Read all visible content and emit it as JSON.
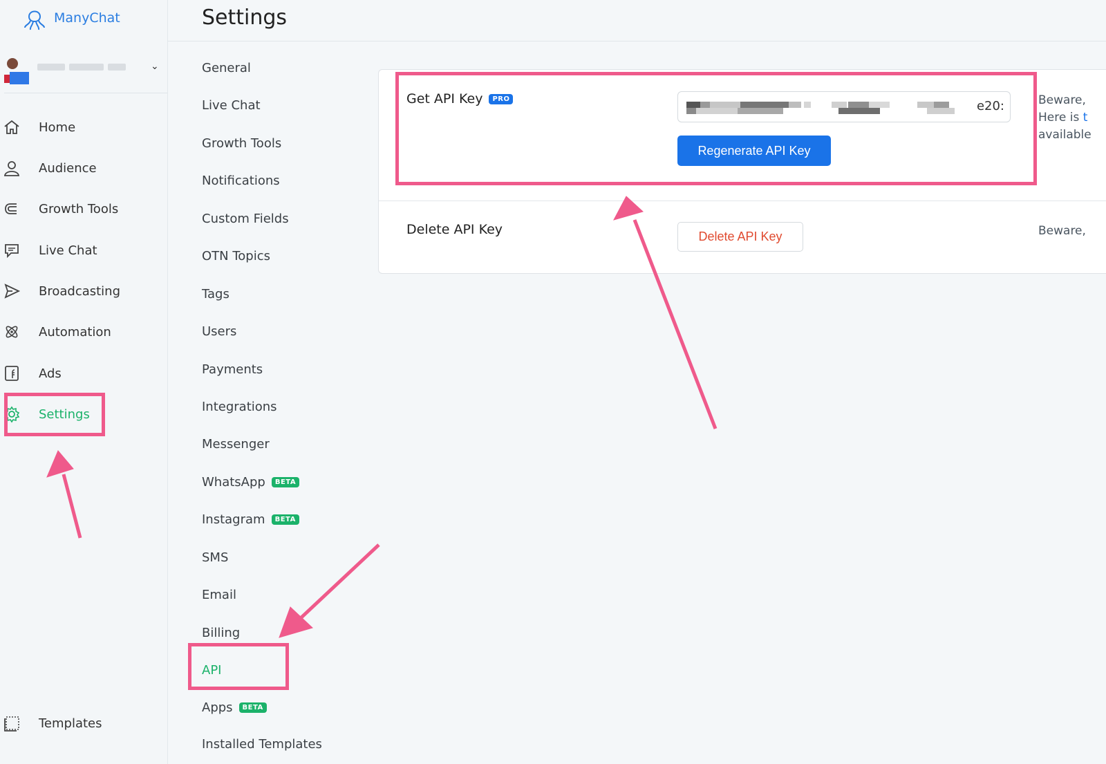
{
  "app": {
    "name": "ManyChat"
  },
  "page_title": "Settings",
  "sidebar": {
    "items": [
      {
        "label": "Home",
        "icon": "home-icon"
      },
      {
        "label": "Audience",
        "icon": "user-icon"
      },
      {
        "label": "Growth Tools",
        "icon": "magnet-icon"
      },
      {
        "label": "Live Chat",
        "icon": "chat-icon"
      },
      {
        "label": "Broadcasting",
        "icon": "send-icon"
      },
      {
        "label": "Automation",
        "icon": "atom-icon"
      },
      {
        "label": "Ads",
        "icon": "facebook-ads-icon"
      },
      {
        "label": "Settings",
        "icon": "gear-icon",
        "active": true
      }
    ],
    "bottom_item": {
      "label": "Templates",
      "icon": "templates-icon"
    }
  },
  "settings_menu": {
    "items": [
      {
        "label": "General"
      },
      {
        "label": "Live Chat"
      },
      {
        "label": "Growth Tools"
      },
      {
        "label": "Notifications"
      },
      {
        "label": "Custom Fields"
      },
      {
        "label": "OTN Topics"
      },
      {
        "label": "Tags"
      },
      {
        "label": "Users"
      },
      {
        "label": "Payments"
      },
      {
        "label": "Integrations"
      },
      {
        "label": "Messenger"
      },
      {
        "label": "WhatsApp",
        "badge": "BETA"
      },
      {
        "label": "Instagram",
        "badge": "BETA"
      },
      {
        "label": "SMS"
      },
      {
        "label": "Email"
      },
      {
        "label": "Billing"
      },
      {
        "label": "API",
        "active": true
      },
      {
        "label": "Apps",
        "badge": "BETA"
      },
      {
        "label": "Installed Templates"
      }
    ]
  },
  "api": {
    "get_key": {
      "label": "Get API Key",
      "badge": "PRO",
      "key_visible_tail": "e20:",
      "regenerate_button": "Regenerate API Key",
      "note_line1": "Beware,",
      "note_line2_prefix": "Here is ",
      "note_line2_link": "t",
      "note_line3": "available"
    },
    "delete_key": {
      "label": "Delete API Key",
      "button": "Delete API Key",
      "note": "Beware,"
    }
  },
  "colors": {
    "accent_green": "#1bb26a",
    "primary_blue": "#1a73e8",
    "danger_red": "#e04a2f",
    "annotation_pink": "#ef5a8b"
  }
}
